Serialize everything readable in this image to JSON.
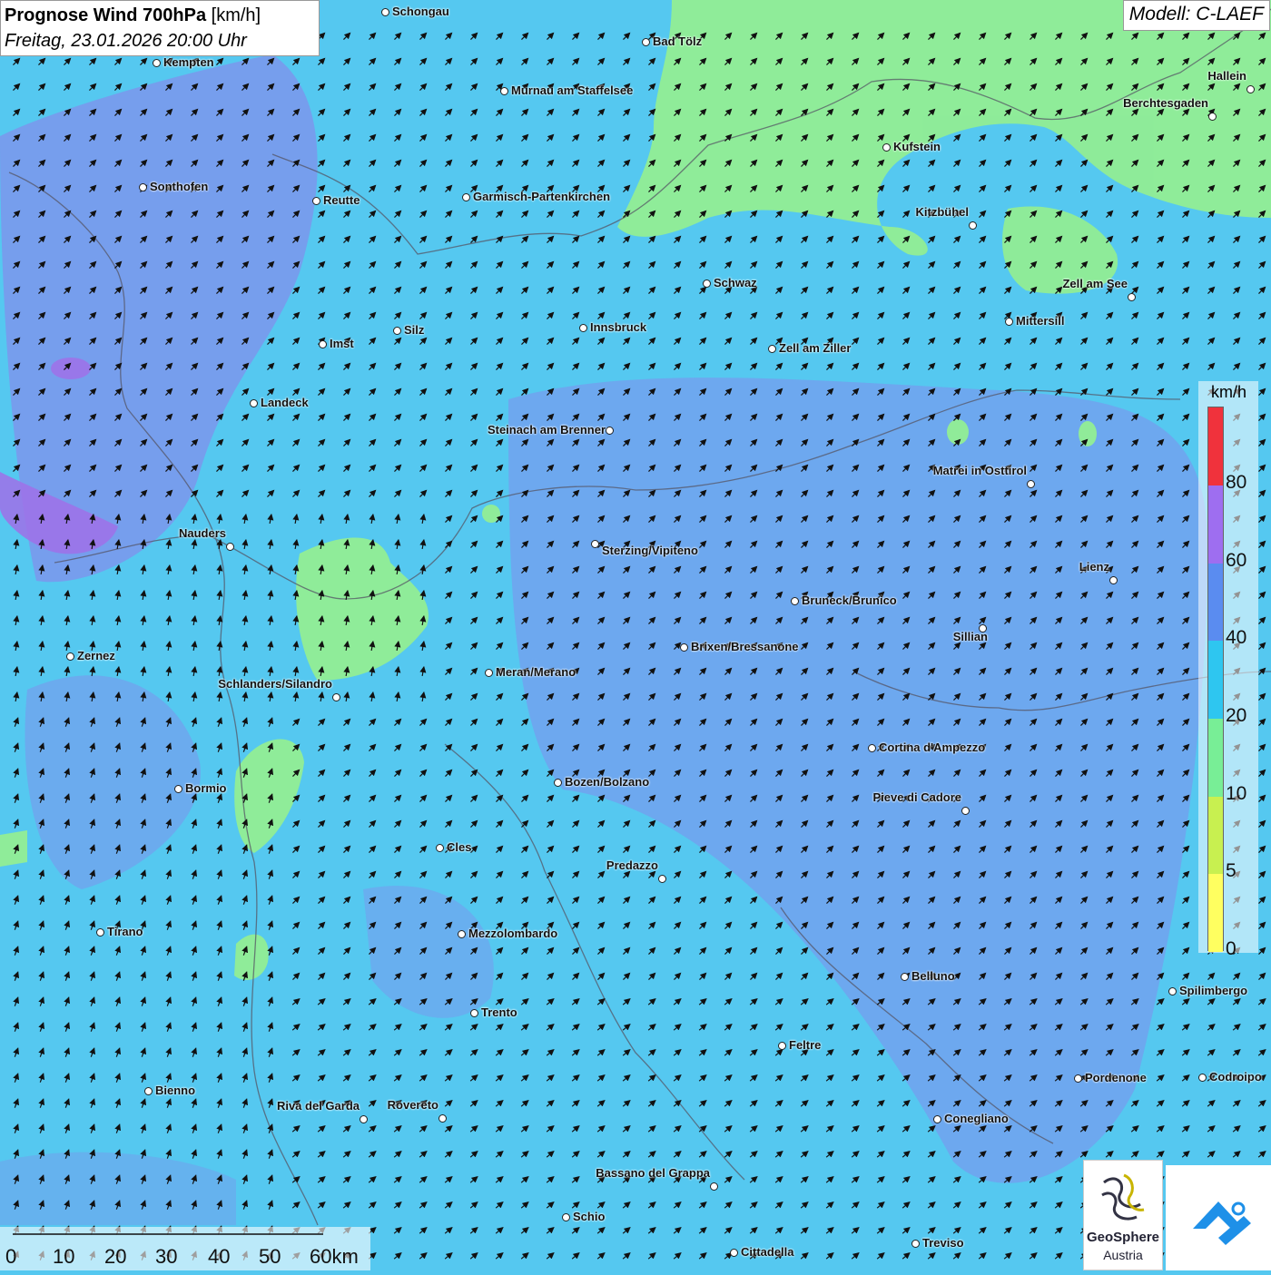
{
  "title": {
    "bold": "Prognose Wind 700hPa",
    "unit": "[km/h]",
    "date": "Freitag, 23.01.2026 20:00 Uhr"
  },
  "model": "Modell: C-LAEF",
  "legend": {
    "unit": "km/h",
    "labels": [
      "80",
      "60",
      "40",
      "20",
      "10",
      "5",
      "0"
    ],
    "colors": [
      "#f0323c",
      "#9e6ef0",
      "#5a8cf0",
      "#2ec6f0",
      "#78ee96",
      "#c8f050",
      "#ffff60"
    ]
  },
  "scale": {
    "labels": [
      "0",
      "10",
      "20",
      "30",
      "40",
      "50",
      "60km"
    ]
  },
  "logo": {
    "name": "GeoSphere",
    "sub": "Austria"
  },
  "colors": {
    "sea_blue": "#55c8f0",
    "purple_blue": "#7c96ec",
    "green": "#90ee90",
    "yellow_green": "#c8f064"
  },
  "wind_direction": "south-west to north-east",
  "cities": [
    {
      "name": "Schongau"
    },
    {
      "name": "Bad Tölz"
    },
    {
      "name": "Kempten"
    },
    {
      "name": "Murnau am Staffelsee"
    },
    {
      "name": "Hallein"
    },
    {
      "name": "Berchtesgaden"
    },
    {
      "name": "Kufstein"
    },
    {
      "name": "Sonthofen"
    },
    {
      "name": "Reutte"
    },
    {
      "name": "Garmisch-Partenkirchen"
    },
    {
      "name": "Kitzbühel"
    },
    {
      "name": "Schwaz"
    },
    {
      "name": "Zell am See"
    },
    {
      "name": "Mittersill"
    },
    {
      "name": "Imst"
    },
    {
      "name": "Silz"
    },
    {
      "name": "Innsbruck"
    },
    {
      "name": "Zell am Ziller"
    },
    {
      "name": "Landeck"
    },
    {
      "name": "Steinach am Brenner"
    },
    {
      "name": "Matrei in Osttirol"
    },
    {
      "name": "Nauders"
    },
    {
      "name": "Sterzing/Vipiteno"
    },
    {
      "name": "Lienz"
    },
    {
      "name": "Bruneck/Brunico"
    },
    {
      "name": "Sillian"
    },
    {
      "name": "Zernez"
    },
    {
      "name": "Brixen/Bressanone"
    },
    {
      "name": "Meran/Merano"
    },
    {
      "name": "Schlanders/Silandro"
    },
    {
      "name": "Cortina d'Ampezzo"
    },
    {
      "name": "Bormio"
    },
    {
      "name": "Bozen/Bolzano"
    },
    {
      "name": "Pieve di Cadore"
    },
    {
      "name": "Cles"
    },
    {
      "name": "Predazzo"
    },
    {
      "name": "Tirano"
    },
    {
      "name": "Mezzolombardo"
    },
    {
      "name": "Belluno"
    },
    {
      "name": "Spilimbergo"
    },
    {
      "name": "Trento"
    },
    {
      "name": "Feltre"
    },
    {
      "name": "Pordenone"
    },
    {
      "name": "Codroipo"
    },
    {
      "name": "Bienno"
    },
    {
      "name": "Riva del Garda"
    },
    {
      "name": "Rovereto"
    },
    {
      "name": "Conegliano"
    },
    {
      "name": "Bassano del Grappa"
    },
    {
      "name": "Schio"
    },
    {
      "name": "Treviso"
    },
    {
      "name": "Cittadella"
    }
  ]
}
